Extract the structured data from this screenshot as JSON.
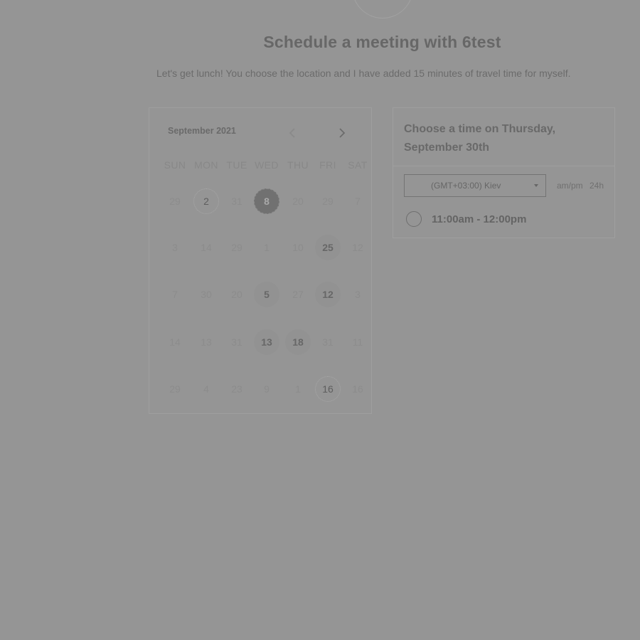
{
  "header": {
    "title": "Schedule a meeting with 6test",
    "description": "Let's get lunch! You choose the location and I have added 15 minutes of travel time for myself."
  },
  "calendar": {
    "month_label": "September 2021",
    "prev_icon": "chevron-left-icon",
    "next_icon": "chevron-right-icon",
    "weekdays": [
      "SUN",
      "MON",
      "TUE",
      "WED",
      "THU",
      "FRI",
      "SAT"
    ],
    "weeks": [
      [
        "29",
        "2",
        "31",
        "8",
        "20",
        "29",
        "7"
      ],
      [
        "3",
        "14",
        "29",
        "1",
        "10",
        "25",
        "12"
      ],
      [
        "7",
        "30",
        "20",
        "5",
        "27",
        "12",
        "3"
      ],
      [
        "14",
        "13",
        "31",
        "13",
        "18",
        "31",
        "11"
      ],
      [
        "29",
        "4",
        "23",
        "9",
        "1",
        "16",
        "16"
      ]
    ],
    "available_days": [
      "25",
      "5",
      "12",
      "13",
      "18"
    ],
    "selected_day": "8",
    "today_markers": [
      "2",
      "16"
    ]
  },
  "time_picker": {
    "heading": "Choose a time on Thursday, September 30th",
    "timezone": "(GMT+03:00) Kiev",
    "format_12h": "am/pm",
    "format_24h": "24h",
    "slots": [
      "11:00am - 12:00pm"
    ]
  },
  "colors": {
    "overlay_background": "#959595",
    "selected_day": "#717171"
  }
}
